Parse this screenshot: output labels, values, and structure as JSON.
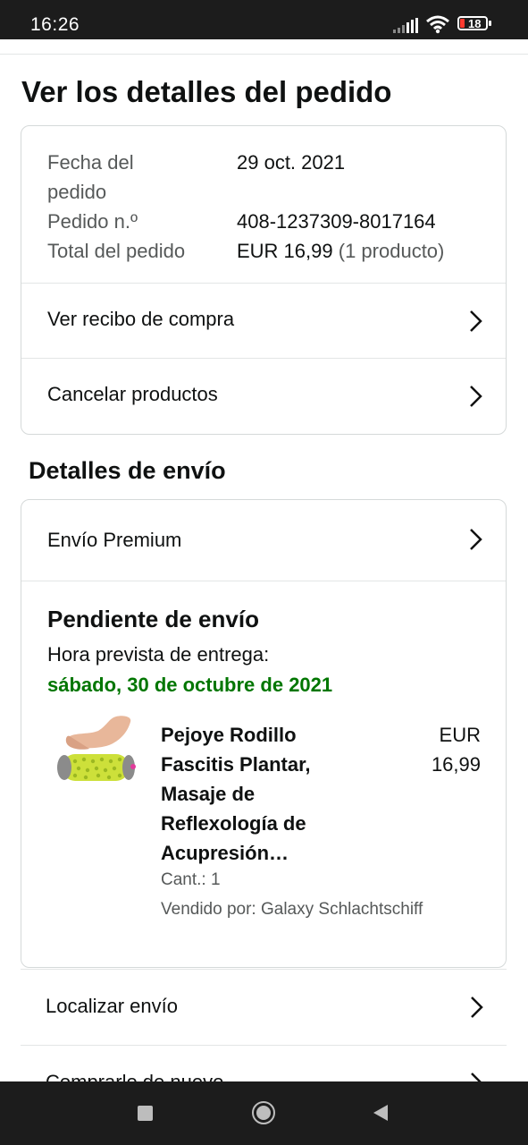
{
  "status_bar": {
    "time": "16:26",
    "battery": "18"
  },
  "page": {
    "title": "Ver los detalles del pedido"
  },
  "order_summary": {
    "date_label": "Fecha del pedido",
    "date_label_line1": "Fecha del",
    "date_label_line2": "pedido",
    "date_value": "29 oct. 2021",
    "number_label": "Pedido n.º",
    "number_value": "408-1237309-8017164",
    "total_label": "Total del pedido",
    "total_value": "EUR 16,99",
    "total_count": "(1 producto)",
    "links": [
      {
        "label": "Ver recibo de compra"
      },
      {
        "label": "Cancelar productos"
      }
    ]
  },
  "shipping": {
    "section_title": "Detalles de envío",
    "method": "Envío Premium",
    "status": "Pendiente de envío",
    "eta_label": "Hora prevista de entrega:",
    "eta_date": "sábado, 30 de octubre de 2021",
    "product": {
      "title": "Pejoye Rodillo Fascitis Plantar, Masaje de Reflexología de Acupresión…",
      "price_currency": "EUR",
      "price_amount": "16,99",
      "qty": "Cant.: 1",
      "seller": "Vendido por: Galaxy Schlachtschiff"
    }
  },
  "actions": [
    {
      "label": "Localizar envío"
    },
    {
      "label": "Comprarlo de nuevo"
    }
  ],
  "colors": {
    "eta_green": "#007600",
    "border": "#d5d9d9",
    "muted": "#565959"
  }
}
